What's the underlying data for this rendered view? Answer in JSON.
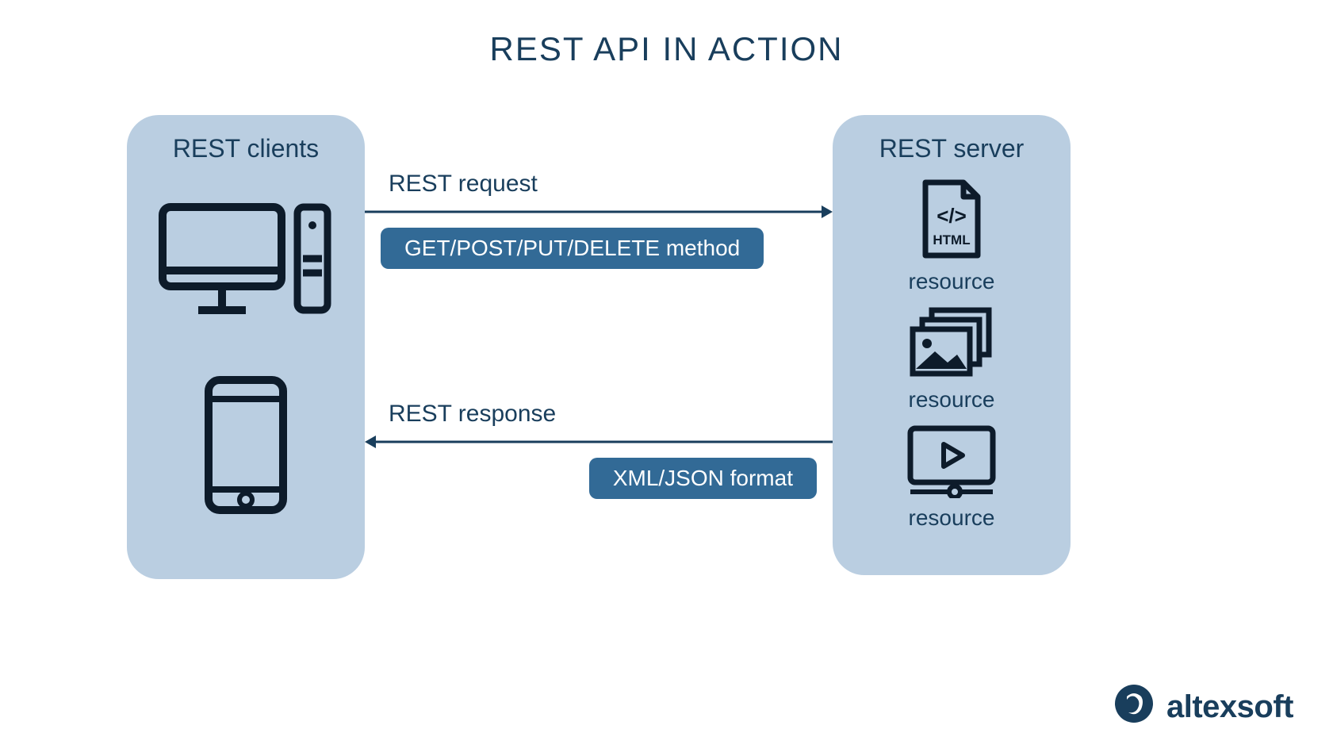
{
  "title": "REST API IN ACTION",
  "clients": {
    "title": "REST clients"
  },
  "server": {
    "title": "REST server",
    "resources": {
      "html": "resource",
      "images": "resource",
      "video": "resource"
    }
  },
  "request": {
    "label": "REST request",
    "pill": "GET/POST/PUT/DELETE method"
  },
  "response": {
    "label": "REST response",
    "pill": "XML/JSON format"
  },
  "brand": "altexsoft",
  "colors": {
    "panel": "#bacee1",
    "pill": "#326a96",
    "text": "#193e5c",
    "lines": "#0d1b2a"
  }
}
